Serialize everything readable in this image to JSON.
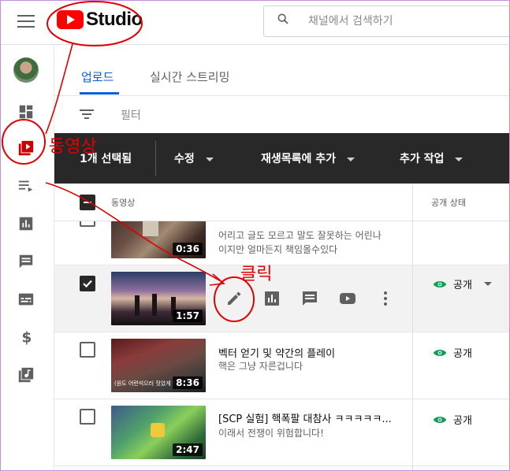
{
  "app": {
    "logo_text": "Studio",
    "brand_red": "#ff0000",
    "accent_blue": "#065fd4"
  },
  "search": {
    "placeholder": "채널에서 검색하기"
  },
  "sidebar": {
    "items": [
      {
        "name": "dashboard",
        "icon": "dashboard-icon"
      },
      {
        "name": "videos",
        "icon": "video-library-icon"
      },
      {
        "name": "playlists",
        "icon": "playlist-icon"
      },
      {
        "name": "analytics",
        "icon": "analytics-icon"
      },
      {
        "name": "comments",
        "icon": "comments-icon"
      },
      {
        "name": "subtitles",
        "icon": "subtitles-icon"
      },
      {
        "name": "monetization",
        "icon": "dollar-icon"
      },
      {
        "name": "audio-library",
        "icon": "audio-library-icon"
      }
    ]
  },
  "tabs": [
    {
      "label": "업로드",
      "active": true
    },
    {
      "label": "실시간 스트리밍",
      "active": false
    }
  ],
  "filter": {
    "label": "필터"
  },
  "action_bar": {
    "selected": "1개 선택됨",
    "edit": "수정",
    "add_playlist": "재생목록에 추가",
    "more_actions": "추가 작업"
  },
  "list_header": {
    "video": "동영상",
    "visibility": "공개 상태"
  },
  "rows": [
    {
      "title": "",
      "desc_line1": "어리고 글도 모르고 말도 잘못하는 어린나",
      "desc_line2": "이지만 얼마든지 책임올수있다",
      "duration": "0:36",
      "visibility": "",
      "checked": false
    },
    {
      "title": "",
      "desc_line1": "",
      "desc_line2": "",
      "duration": "1:57",
      "visibility": "공개",
      "checked": true
    },
    {
      "title": "벡터 얻기 및 약간의 플레이",
      "desc_line1": "핵은 그냥 자른겁니다",
      "desc_line2": "",
      "duration": "8:36",
      "thumb_caption": "(원도 어련석으러 젓았게 !",
      "visibility": "공개",
      "checked": false
    },
    {
      "title": "[SCP 실험] 핵폭팔 대참사 ㅋㅋㅋㅋㅋ...",
      "desc_line1": "이래서 전쟁이 위험합니다!",
      "desc_line2": "",
      "duration": "2:47",
      "visibility": "공개",
      "checked": false
    }
  ],
  "annotations": {
    "videos_label": "동영상",
    "click_label": "클릭",
    "color": "#e00000"
  }
}
